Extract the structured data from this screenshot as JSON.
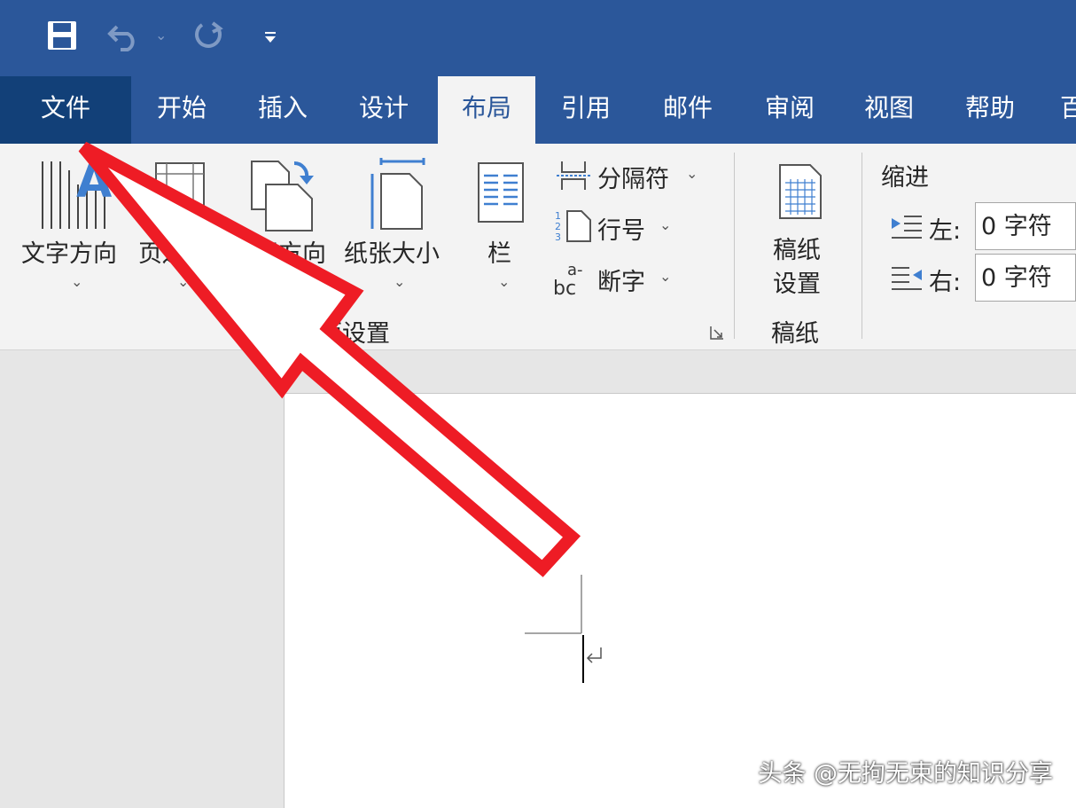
{
  "quick_access": {
    "icons": [
      "save-icon",
      "undo-icon",
      "redo-icon",
      "customize-icon"
    ]
  },
  "tabs": [
    {
      "label": "文件"
    },
    {
      "label": "开始"
    },
    {
      "label": "插入"
    },
    {
      "label": "设计"
    },
    {
      "label": "布局"
    },
    {
      "label": "引用"
    },
    {
      "label": "邮件"
    },
    {
      "label": "审阅"
    },
    {
      "label": "视图"
    },
    {
      "label": "帮助"
    },
    {
      "label": "百"
    }
  ],
  "active_tab": "布局",
  "ribbon": {
    "page_setup": {
      "text_direction": "文字方向",
      "margins": "页边距",
      "orientation": "纸张方向",
      "size": "纸张大小",
      "columns": "栏",
      "breaks": "分隔符",
      "line_numbers": "行号",
      "hyphenation": "断字",
      "group_label": "页面设置"
    },
    "manuscript": {
      "button_line1": "稿纸",
      "button_line2": "设置",
      "group_label": "稿纸"
    },
    "indent": {
      "title": "缩进",
      "left_label": "左:",
      "left_value": "0 字符",
      "right_label": "右:",
      "right_value": "0 字符"
    }
  },
  "watermark": "头条 @无拘无束的知识分享",
  "colors": {
    "ribbon_blue": "#2b579a",
    "arrow_red": "#ee1c25"
  }
}
